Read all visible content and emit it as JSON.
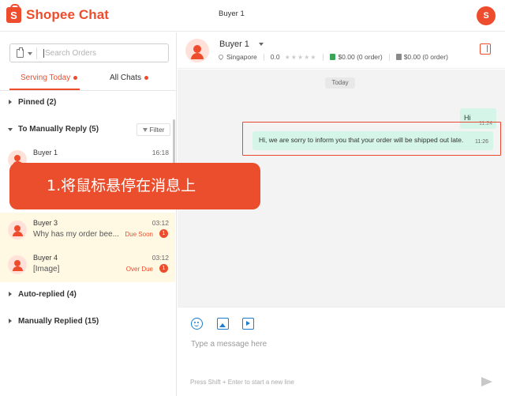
{
  "app": {
    "brand": "Shopee",
    "brand_suffix": "Chat",
    "title": "Buyer 1",
    "logo_letter": "S",
    "accent_color": "#ee4d2d"
  },
  "search": {
    "placeholder": "Search Orders"
  },
  "tabs": [
    {
      "label": "Serving Today",
      "active": true
    },
    {
      "label": "All Chats",
      "active": false
    }
  ],
  "groups": {
    "pinned": "Pinned (2)",
    "to_reply": "To Manually Reply (5)",
    "filter": "Filter",
    "auto_replied": "Auto-replied (4)",
    "manually_replied": "Manually Replied (15)"
  },
  "conversations": [
    {
      "name": "Buyer 1",
      "time": "16:18",
      "message": "",
      "due": "",
      "badge": ""
    },
    {
      "name": "Buyer 3",
      "time": "03:12",
      "message": "Why has my order bee...",
      "due": "Due Soon",
      "badge": "1"
    },
    {
      "name": "Buyer 4",
      "time": "03:12",
      "message": "[Image]",
      "due": "Over Due",
      "badge": "1"
    }
  ],
  "overlay": {
    "text": "1.将鼠标悬停在消息上"
  },
  "chat_header": {
    "name": "Buyer 1",
    "location": "Singapore",
    "rating": "0.0",
    "stars": "★★★★★",
    "order_paid": "$0.00 (0 order)",
    "order_other": "$0.00 (0 order)"
  },
  "messages": {
    "date_label": "Today",
    "items": [
      {
        "text": "Hi",
        "time": "11:24"
      },
      {
        "text": "Hi, we are sorry to inform you that your order will be shipped out late.",
        "time": "11:26"
      }
    ]
  },
  "composer": {
    "placeholder": "Type a message here",
    "hint": "Press Shift + Enter to start a new line"
  }
}
